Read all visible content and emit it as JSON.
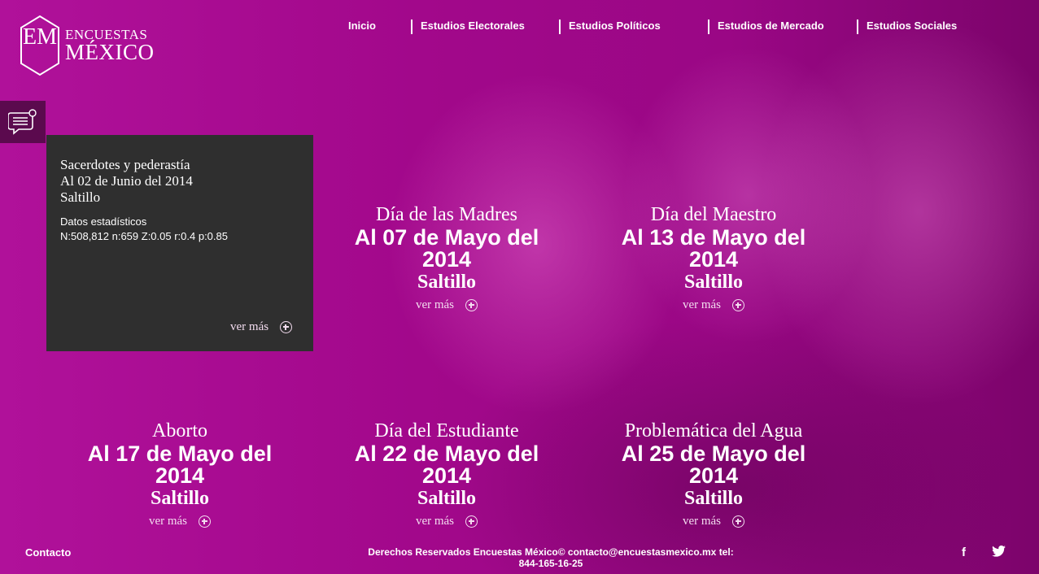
{
  "brand": {
    "logo_monogram": "EM",
    "name_top": "ENCUESTAS",
    "name_bottom": "MÉXICO"
  },
  "nav": {
    "items": [
      {
        "label": "Inicio"
      },
      {
        "label": "Estudios Electorales"
      },
      {
        "label": "Estudios Políticos"
      },
      {
        "label": "Estudios de Mercado"
      },
      {
        "label": "Estudios Sociales"
      }
    ]
  },
  "side_tab": {
    "icon": "message-icon"
  },
  "featured": {
    "title": "Sacerdotes y pederastía",
    "date": "Al 02 de Junio del 2014",
    "city": "Saltillo",
    "stats_label": "Datos estadísticos",
    "stats": "N:508,812 n:659 Z:0.05 r:0.4 p:0.85",
    "more_label": "ver más"
  },
  "cards": [
    {
      "title": "Día de las Madres",
      "date_line1": "Al 07 de Mayo del",
      "date_line2": "2014",
      "city": "Saltillo",
      "more_label": "ver más"
    },
    {
      "title": "Día del Maestro",
      "date_line1": "Al 13 de Mayo del",
      "date_line2": "2014",
      "city": "Saltillo",
      "more_label": "ver más"
    },
    {
      "title": "Aborto",
      "date_line1": "Al 17 de Mayo del",
      "date_line2": "2014",
      "city": "Saltillo",
      "more_label": "ver más"
    },
    {
      "title": "Día del Estudiante",
      "date_line1": "Al 22 de Mayo del",
      "date_line2": "2014",
      "city": "Saltillo",
      "more_label": "ver más"
    },
    {
      "title": "Problemática del Agua",
      "date_line1": "Al 25 de Mayo del",
      "date_line2": "2014",
      "city": "Saltillo",
      "more_label": "ver más"
    }
  ],
  "footer": {
    "contact_label": "Contacto",
    "copyright_line1": "Derechos Reservados Encuestas México© contacto@encuestasmexico.mx tel:",
    "copyright_line2": "844-165-16-25",
    "social": [
      {
        "label": "f",
        "icon": "facebook-icon"
      },
      {
        "label": "twitter",
        "icon": "twitter-icon"
      }
    ]
  },
  "colors": {
    "background": "#a8098d",
    "panel": "#2f2f2f",
    "side_tab": "#5b0a4e",
    "text": "#ffffff"
  }
}
